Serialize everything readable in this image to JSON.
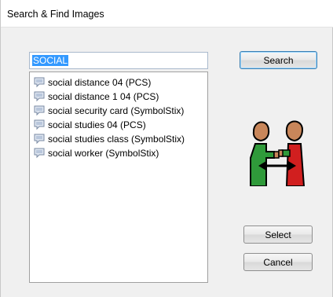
{
  "window": {
    "title": "Search & Find Images"
  },
  "search": {
    "value": "SOCIAL",
    "button_label": "Search"
  },
  "results": {
    "items": [
      {
        "label": "social distance 04 (PCS)",
        "icon": "speech-bubble-icon"
      },
      {
        "label": "social distance 1 04 (PCS)",
        "icon": "speech-bubble-icon"
      },
      {
        "label": "social security card (SymbolStix)",
        "icon": "speech-bubble-icon"
      },
      {
        "label": "social studies 04 (PCS)",
        "icon": "speech-bubble-icon"
      },
      {
        "label": "social studies class (SymbolStix)",
        "icon": "speech-bubble-icon"
      },
      {
        "label": "social worker (SymbolStix)",
        "icon": "speech-bubble-icon"
      }
    ]
  },
  "preview": {
    "icon": "social-distance-people-icon",
    "colors": {
      "left_figure": "#2f9a3a",
      "right_figure": "#d11f1f",
      "skin": "#c8865a",
      "arrow": "#000000"
    }
  },
  "buttons": {
    "select_label": "Select",
    "cancel_label": "Cancel"
  }
}
